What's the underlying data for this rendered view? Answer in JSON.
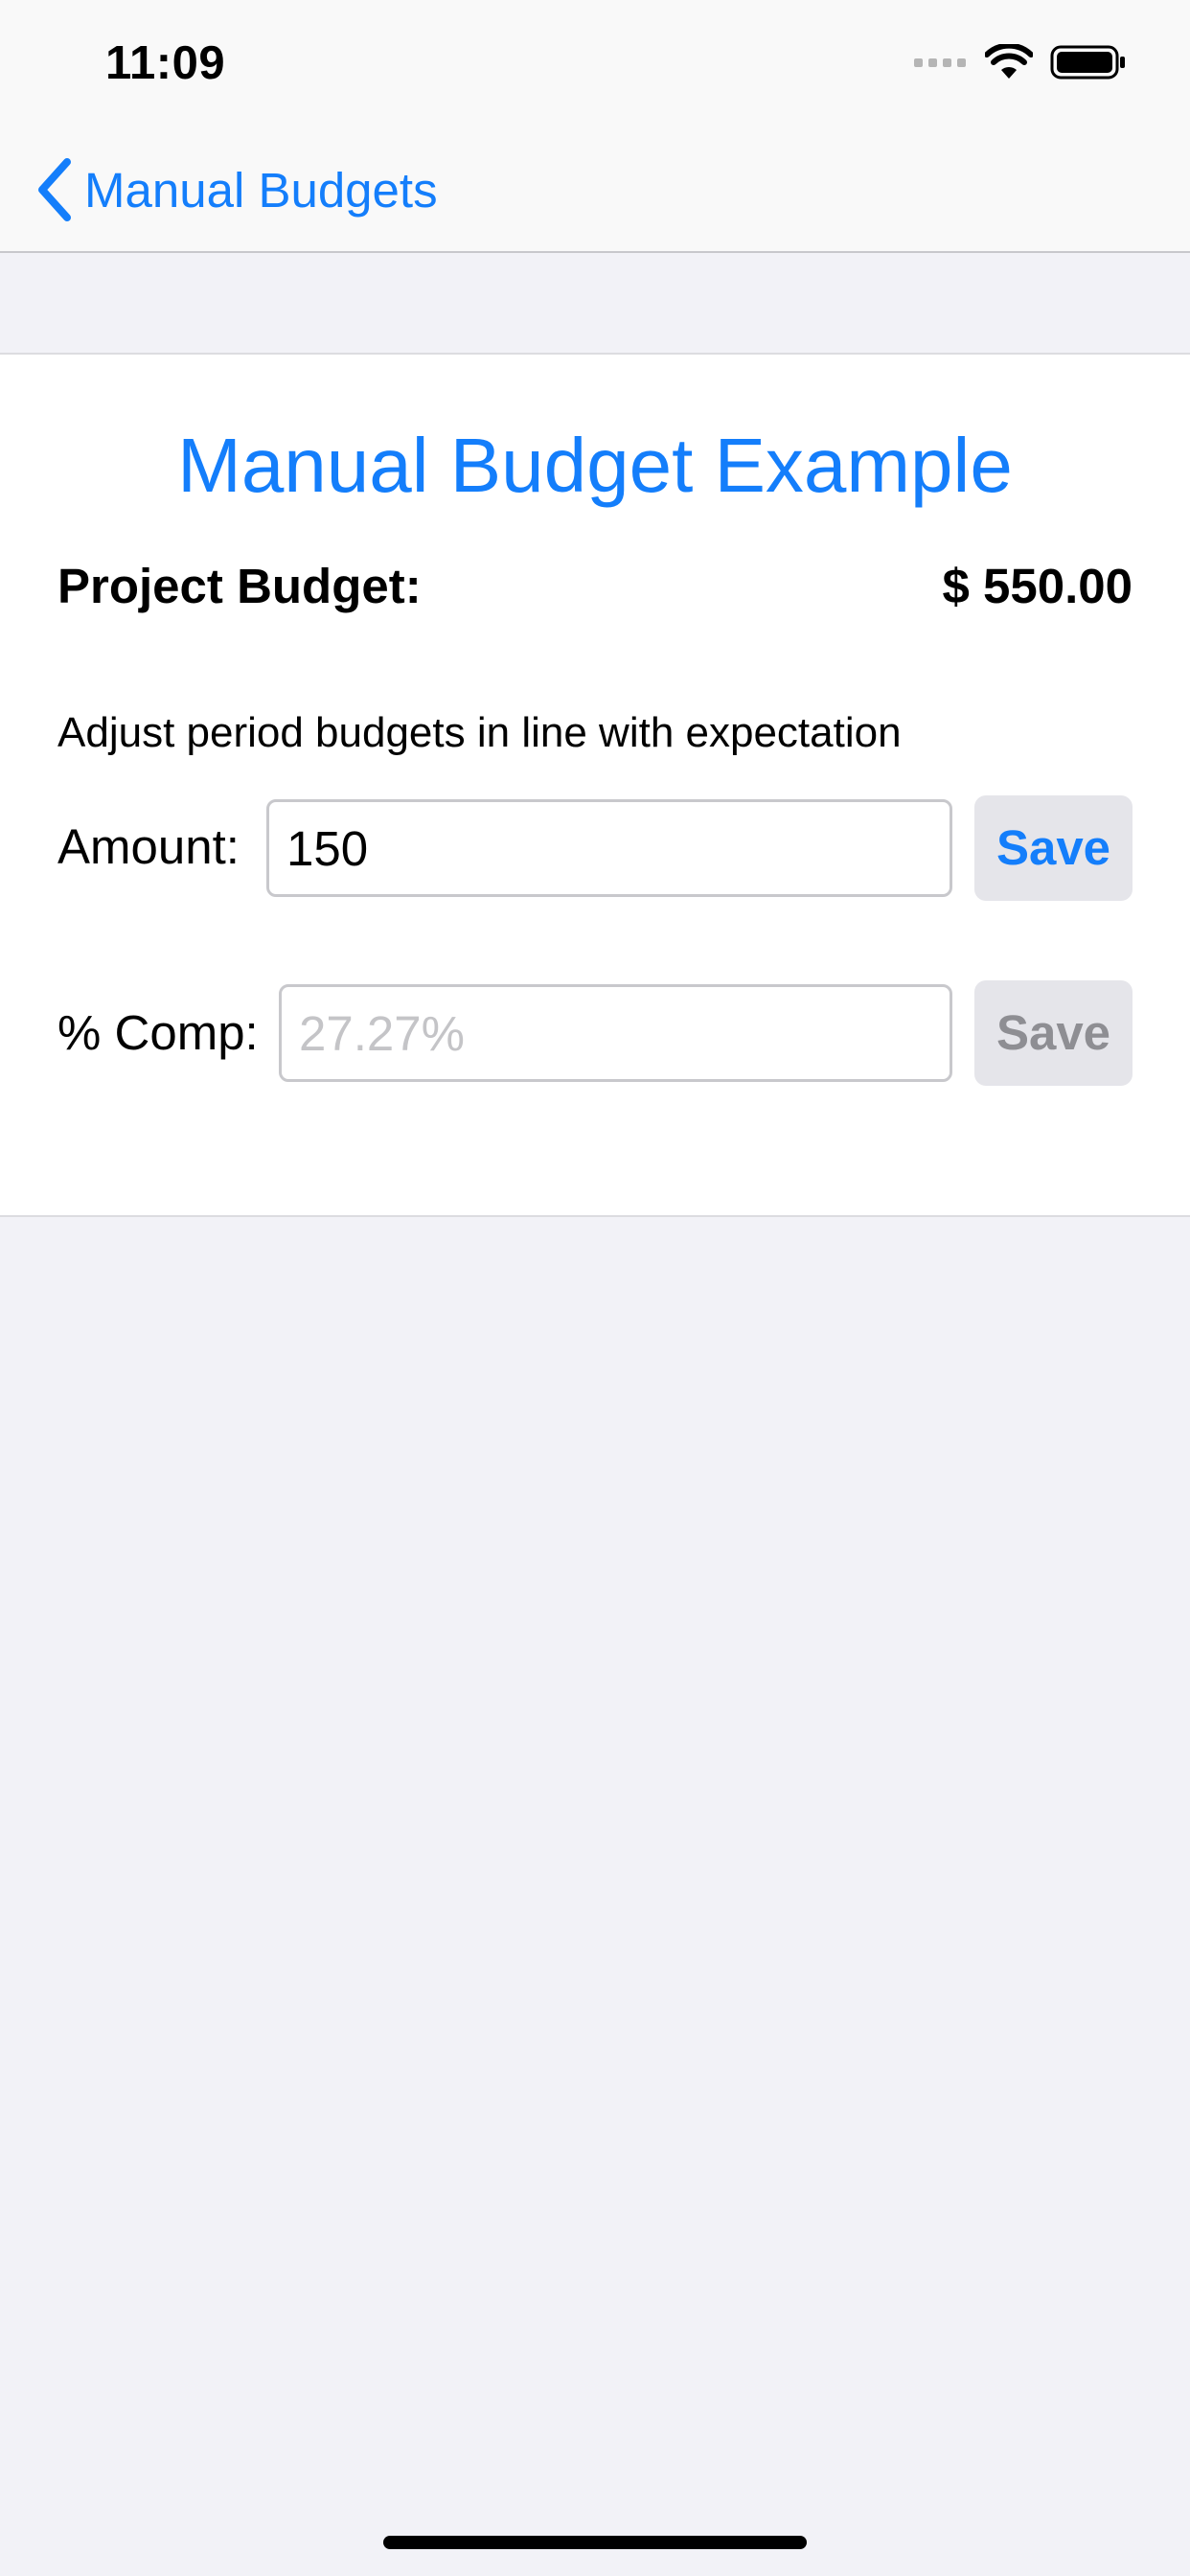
{
  "status_bar": {
    "time": "11:09",
    "icons": [
      "cellular-signal-icon",
      "wifi-icon",
      "battery-icon"
    ]
  },
  "nav": {
    "back_label": "Manual Budgets",
    "back_icon": "chevron-left-icon"
  },
  "card": {
    "title": "Manual Budget Example",
    "budget_label": "Project Budget:",
    "budget_value": "$ 550.00",
    "hint": "Adjust period budgets in line with expectation",
    "amount": {
      "label": "Amount:",
      "value": "150",
      "save_label": "Save",
      "save_enabled": true
    },
    "percent_complete": {
      "label": "% Comp:",
      "placeholder": "27.27%",
      "value": "",
      "save_label": "Save",
      "save_enabled": false
    }
  },
  "colors": {
    "accent": "#147efb",
    "background": "#f2f2f7",
    "disabled_text": "#8e8e93",
    "button_fill": "#e5e5ea"
  }
}
